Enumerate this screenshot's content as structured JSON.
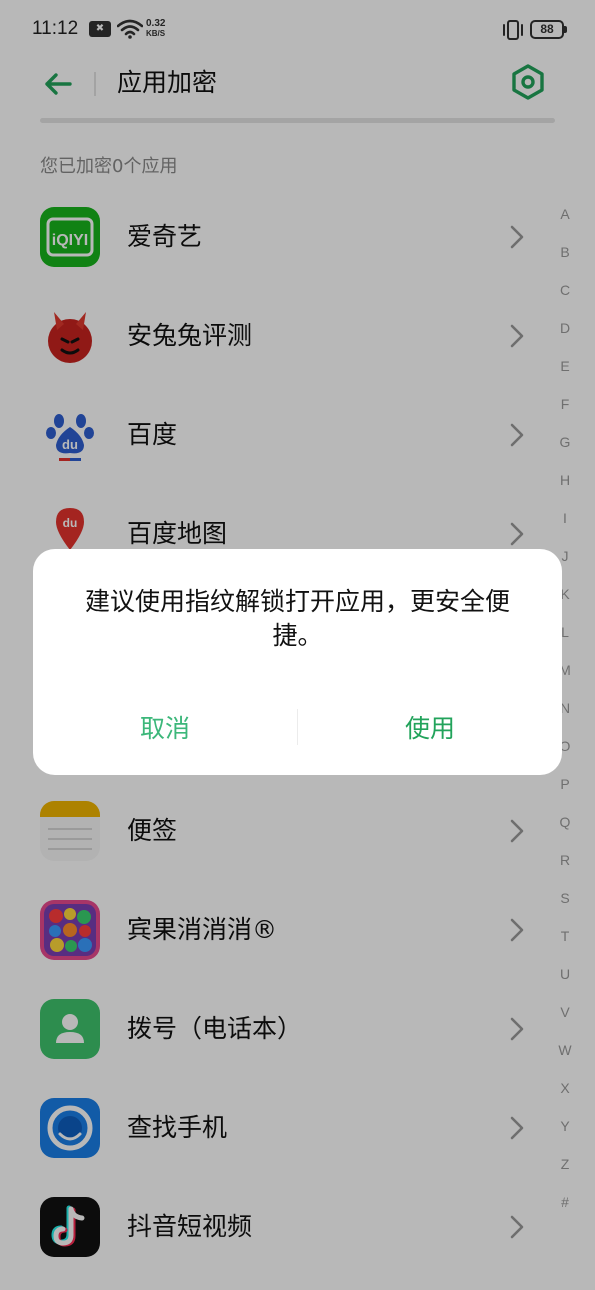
{
  "status_bar": {
    "time": "11:12",
    "net_speed_value": "0.32",
    "net_speed_unit": "KB/S",
    "battery": "88"
  },
  "header": {
    "title": "应用加密"
  },
  "encrypted_count": "您已加密0个应用",
  "apps": [
    {
      "name": "爱奇艺",
      "icon": "iqiyi-icon"
    },
    {
      "name": "安兔兔评测",
      "icon": "antutu-icon"
    },
    {
      "name": "百度",
      "icon": "baidu-icon"
    },
    {
      "name": "百度地图",
      "icon": "baidu-map-icon"
    },
    {
      "name": "便签",
      "icon": "notes-icon"
    },
    {
      "name": "宾果消消消®",
      "icon": "bingo-candy-icon"
    },
    {
      "name": "拨号（电话本）",
      "icon": "dialer-icon"
    },
    {
      "name": "查找手机",
      "icon": "find-phone-icon"
    },
    {
      "name": "抖音短视频",
      "icon": "douyin-icon"
    }
  ],
  "alpha_index": [
    "A",
    "B",
    "C",
    "D",
    "E",
    "F",
    "G",
    "H",
    "I",
    "J",
    "K",
    "L",
    "M",
    "N",
    "O",
    "P",
    "Q",
    "R",
    "S",
    "T",
    "U",
    "V",
    "W",
    "X",
    "Y",
    "Z",
    "#"
  ],
  "dialog": {
    "message": "建议使用指纹解锁打开应用，更安全便捷。",
    "cancel_label": "取消",
    "confirm_label": "使用"
  },
  "colors": {
    "accent": "#22a35b",
    "overlay": "rgba(0,0,0,0.28)"
  }
}
